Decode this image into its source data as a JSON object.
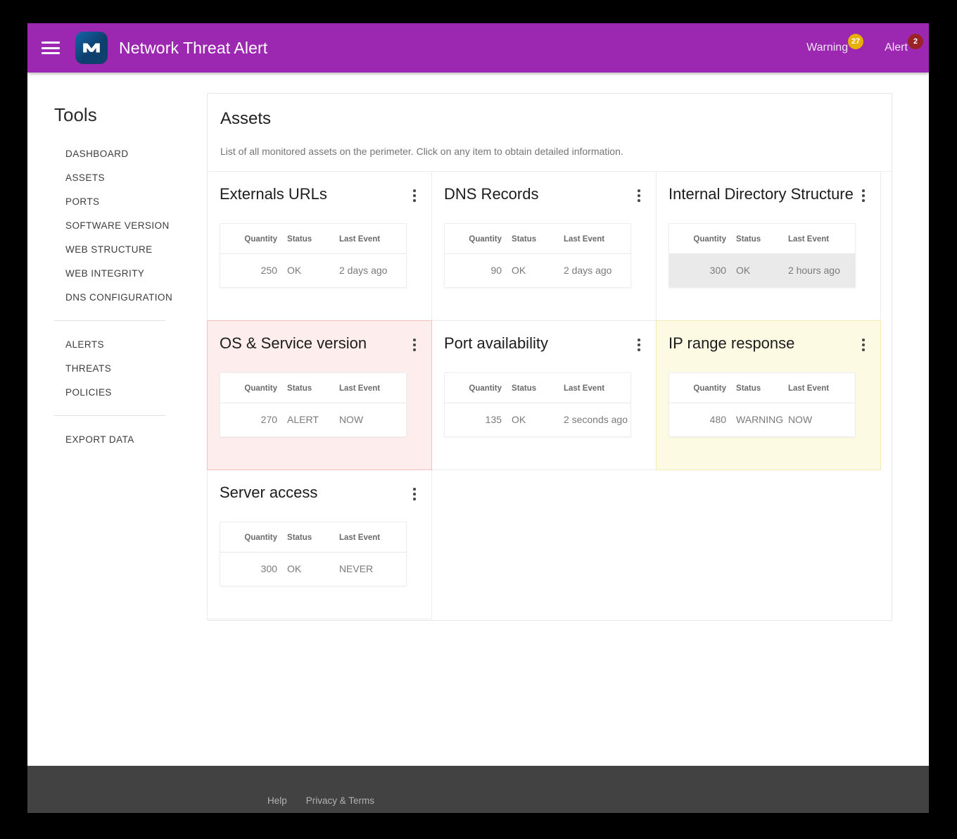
{
  "app_bar": {
    "menu_icon": "hamburger-menu-icon",
    "logo_icon": "brand-logo-icon",
    "title": "Network Threat Alert",
    "actions": [
      {
        "label": "Warning",
        "badge": "27",
        "badge_color": "#e8b007"
      },
      {
        "label": "Alert",
        "badge": "2",
        "badge_color": "#9b2226"
      }
    ]
  },
  "sidebar": {
    "heading": "Tools",
    "groups": [
      {
        "items": [
          {
            "label": "DASHBOARD",
            "key": "dashboard"
          },
          {
            "label": "ASSETS",
            "key": "assets"
          },
          {
            "label": "PORTS",
            "key": "ports"
          },
          {
            "label": "SOFTWARE VERSION",
            "key": "software-version"
          },
          {
            "label": "WEB STRUCTURE",
            "key": "web-structure"
          },
          {
            "label": "WEB INTEGRITY",
            "key": "web-integrity"
          },
          {
            "label": "DNS CONFIGURATION",
            "key": "dns-configuration"
          }
        ]
      },
      {
        "items": [
          {
            "label": "ALERTS",
            "key": "alerts"
          },
          {
            "label": "THREATS",
            "key": "threats"
          },
          {
            "label": "POLICIES",
            "key": "policies"
          }
        ]
      },
      {
        "items": [
          {
            "label": "EXPORT DATA",
            "key": "export-data"
          }
        ]
      }
    ]
  },
  "panel": {
    "title": "Assets",
    "subtitle": "List of all monitored assets on the perimeter. Click on any item to obtain detailed information."
  },
  "table_headers": {
    "quantity": "Quantity",
    "status": "Status",
    "last_event": "Last Event"
  },
  "cards": [
    {
      "title": "Externals URLs",
      "key": "externals-urls",
      "state": "normal",
      "row_hover": false,
      "quantity": "250",
      "status": "OK",
      "last_event": "2 days ago"
    },
    {
      "title": "DNS Records",
      "key": "dns-records",
      "state": "normal",
      "row_hover": false,
      "quantity": "90",
      "status": "OK",
      "last_event": "2 days ago"
    },
    {
      "title": "Internal Directory Structure",
      "key": "internal-directory-structure",
      "state": "normal",
      "row_hover": true,
      "quantity": "300",
      "status": "OK",
      "last_event": "2 hours ago"
    },
    {
      "title": "OS & Service version",
      "key": "os-service-version",
      "state": "alert",
      "row_hover": false,
      "quantity": "270",
      "status": "ALERT",
      "last_event": "NOW"
    },
    {
      "title": "Port availability",
      "key": "port-availability",
      "state": "normal",
      "row_hover": false,
      "quantity": "135",
      "status": "OK",
      "last_event": "2 seconds ago"
    },
    {
      "title": "IP range response",
      "key": "ip-range-response",
      "state": "warning",
      "row_hover": false,
      "quantity": "480",
      "status": "WARNING",
      "last_event": "NOW"
    },
    {
      "title": "Server access",
      "key": "server-access",
      "state": "normal",
      "row_hover": false,
      "quantity": "300",
      "status": "OK",
      "last_event": "NEVER"
    }
  ],
  "footer": {
    "links": [
      {
        "label": "Help",
        "key": "help"
      },
      {
        "label": "Privacy & Terms",
        "key": "privacy-terms"
      }
    ]
  },
  "theme": {
    "app_bar_color": "#9c27b0",
    "alert_bg": "#fdeeed",
    "alert_border": "#f3c0bd",
    "warning_bg": "#fdfae3",
    "warning_border": "#f2edb6",
    "footer_bg": "#424242"
  }
}
